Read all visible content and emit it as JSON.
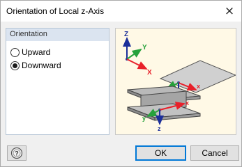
{
  "window": {
    "title": "Orientation of Local z-Axis",
    "close_glyph": "×"
  },
  "orientation_group": {
    "header": "Orientation",
    "options": [
      {
        "label": "Upward",
        "selected": false
      },
      {
        "label": "Downward",
        "selected": true
      }
    ]
  },
  "preview": {
    "global_axes": {
      "x": "X",
      "y": "Y",
      "z": "Z"
    },
    "surface_axes": {
      "x": "x",
      "y": "y",
      "z": "z"
    },
    "member_axes": {
      "x": "x",
      "y": "y",
      "z": "z"
    },
    "colors": {
      "x_axis": "#e8202a",
      "y_axis": "#26a13b",
      "z_axis": "#1c2f9a",
      "background": "#fff9e6"
    }
  },
  "footer": {
    "ok_label": "OK",
    "cancel_label": "Cancel",
    "help_icon": "help-icon"
  }
}
